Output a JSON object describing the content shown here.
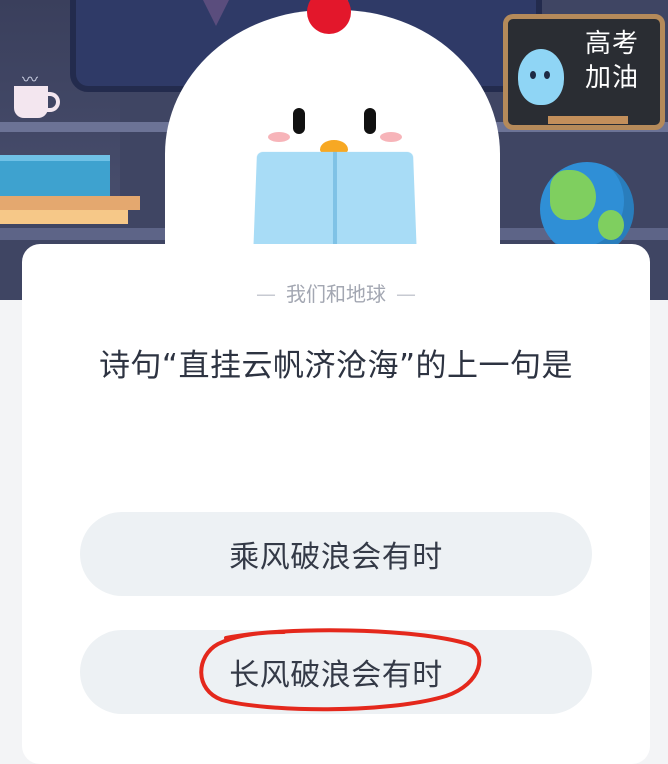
{
  "header_art": {
    "chalkboard_text_line1": "高考",
    "chalkboard_text_line2": "加油"
  },
  "card": {
    "subtitle": "我们和地球",
    "question": "诗句“直挂云帆济沧海”的上一句是",
    "options": [
      {
        "label": "乘风破浪会有时"
      },
      {
        "label": "长风破浪会有时",
        "annotated": "red-hand-drawn-circle"
      }
    ]
  },
  "colors": {
    "background": "#f3f4f6",
    "card": "#ffffff",
    "option_bg": "#edf1f4",
    "annotation": "#e4281c",
    "scene_dark": "#3f4563"
  }
}
